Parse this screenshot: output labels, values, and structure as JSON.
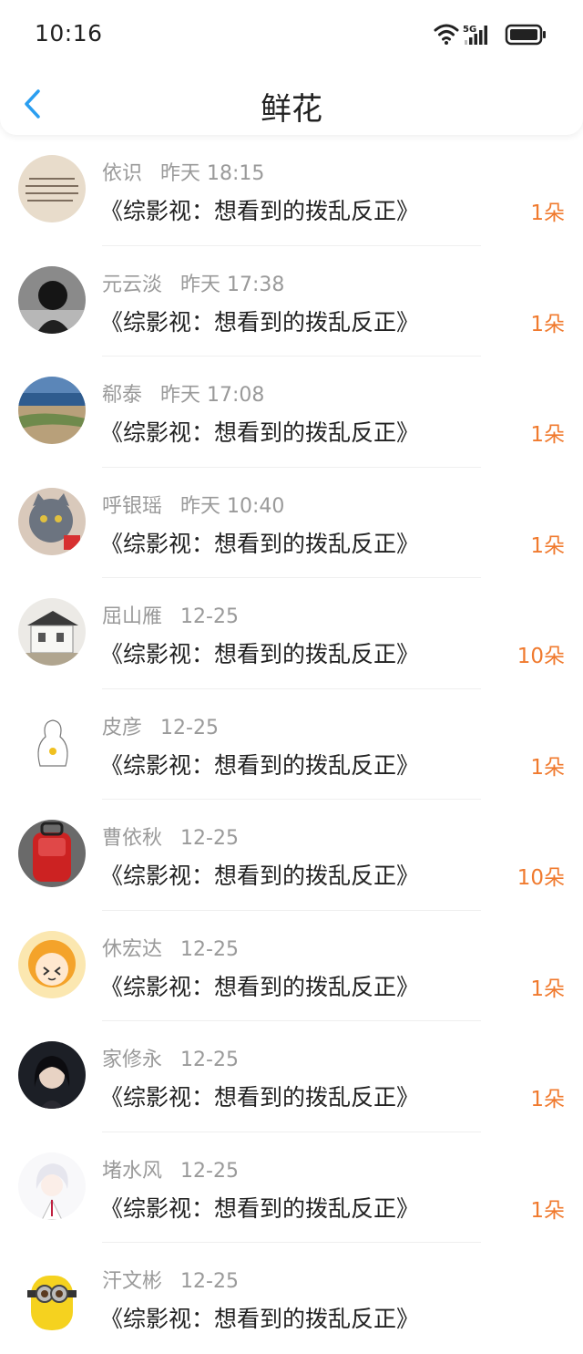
{
  "status_bar": {
    "time": "10:16",
    "network": "5G"
  },
  "header": {
    "title": "鲜花"
  },
  "colors": {
    "count": "#f07a2e",
    "meta": "#9a9a9a",
    "back": "#2a9ef0"
  },
  "items": [
    {
      "name": "依识",
      "time": "昨天 18:15",
      "book": "《综影视：想看到的拨乱反正》",
      "count": "1朵",
      "avatar": "text-image"
    },
    {
      "name": "元云淡",
      "time": "昨天 17:38",
      "book": "《综影视：想看到的拨乱反正》",
      "count": "1朵",
      "avatar": "dark-portrait"
    },
    {
      "name": "郗泰",
      "time": "昨天 17:08",
      "book": "《综影视：想看到的拨乱反正》",
      "count": "1朵",
      "avatar": "seaside"
    },
    {
      "name": "呼银瑶",
      "time": "昨天 10:40",
      "book": "《综影视：想看到的拨乱反正》",
      "count": "1朵",
      "avatar": "cat"
    },
    {
      "name": "屈山雁",
      "time": "12-25",
      "book": "《综影视：想看到的拨乱反正》",
      "count": "10朵",
      "avatar": "building"
    },
    {
      "name": "皮彦",
      "time": "12-25",
      "book": "《综影视：想看到的拨乱反正》",
      "count": "1朵",
      "avatar": "sketch"
    },
    {
      "name": "曹依秋",
      "time": "12-25",
      "book": "《综影视：想看到的拨乱反正》",
      "count": "10朵",
      "avatar": "red-bag"
    },
    {
      "name": "休宏达",
      "time": "12-25",
      "book": "《综影视：想看到的拨乱反正》",
      "count": "1朵",
      "avatar": "cartoon-girl"
    },
    {
      "name": "家修永",
      "time": "12-25",
      "book": "《综影视：想看到的拨乱反正》",
      "count": "1朵",
      "avatar": "dark-hair-girl"
    },
    {
      "name": "堵水风",
      "time": "12-25",
      "book": "《综影视：想看到的拨乱反正》",
      "count": "1朵",
      "avatar": "white-hair-anime"
    },
    {
      "name": "汗文彬",
      "time": "12-25",
      "book": "《综影视：想看到的拨乱反正》",
      "count": "",
      "avatar": "minion"
    }
  ]
}
